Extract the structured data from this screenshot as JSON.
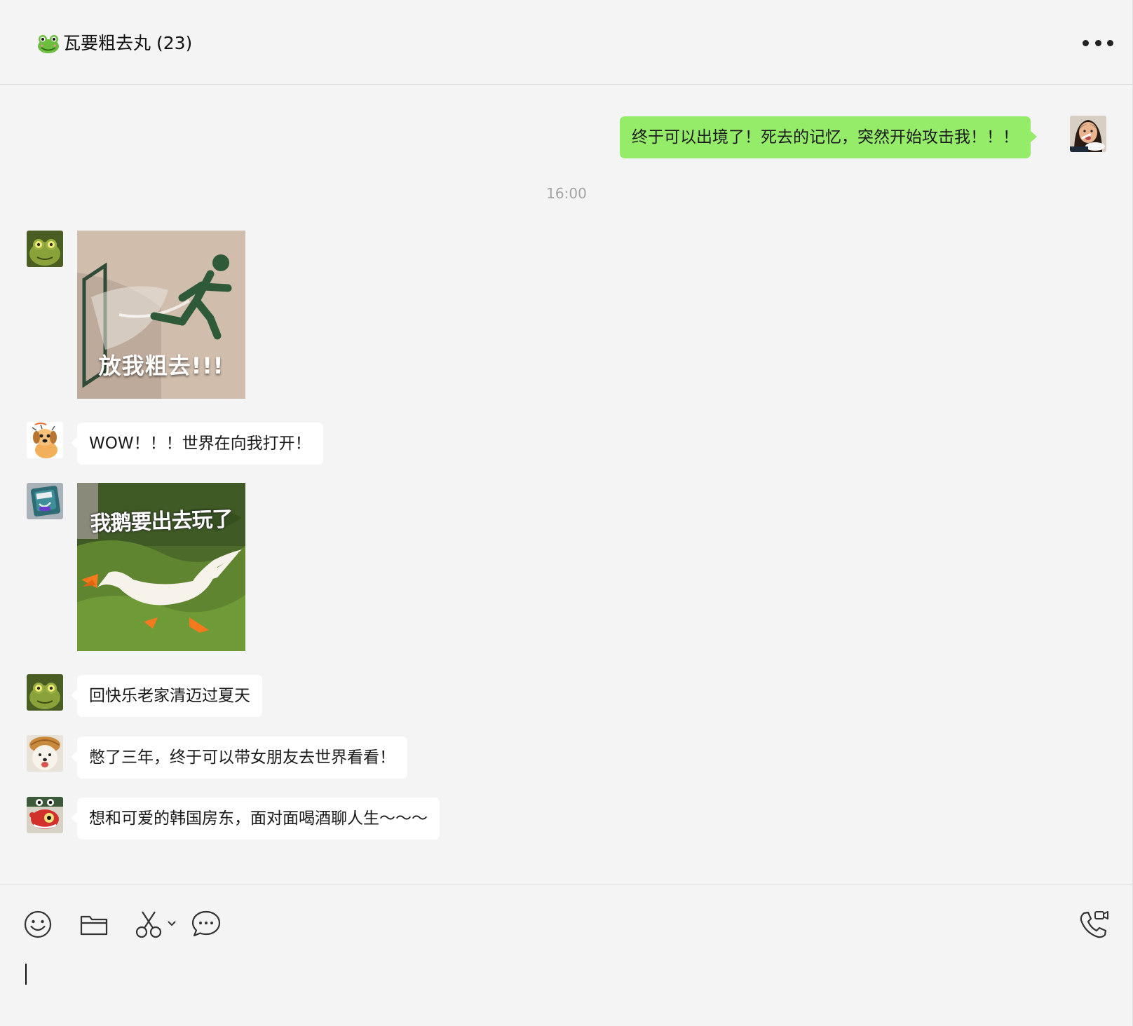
{
  "header": {
    "title": "瓦要粗去丸 (23)",
    "icon": "frog-icon",
    "more_icon": "more-icon"
  },
  "messages": [
    {
      "side": "right",
      "type": "text",
      "text": "终于可以出境了！死去的记忆，突然开始攻击我！！！",
      "avatar": "avatar-girl-eating"
    },
    {
      "type": "timestamp",
      "text": "16:00"
    },
    {
      "side": "left",
      "type": "sticker",
      "caption": "放我粗去!!!",
      "avatar": "avatar-frog"
    },
    {
      "side": "left",
      "type": "text",
      "text": "WOW！！！世界在向我打开！",
      "avatar": "avatar-cartoon-dog"
    },
    {
      "side": "left",
      "type": "sticker",
      "caption": "我鹅要出去玩了",
      "avatar": "avatar-robot"
    },
    {
      "side": "left",
      "type": "text",
      "text": "回快乐老家清迈过夏天",
      "avatar": "avatar-frog"
    },
    {
      "side": "left",
      "type": "text",
      "text": "憋了三年，终于可以带女朋友去世界看看！",
      "avatar": "avatar-puppy"
    },
    {
      "side": "left",
      "type": "text",
      "text": "想和可爱的韩国房东，面对面喝酒聊人生～～～",
      "avatar": "avatar-red-monster"
    }
  ],
  "toolbar": {
    "emoji": "emoji-icon",
    "folder": "folder-icon",
    "screenshot": "scissors-icon",
    "chat_history": "chat-bubble-icon",
    "call": "voice-video-call-icon"
  },
  "colors": {
    "background": "#f4f4f4",
    "self_bubble": "#95ec69",
    "other_bubble": "#ffffff",
    "timestamp": "#a3a3a3"
  }
}
